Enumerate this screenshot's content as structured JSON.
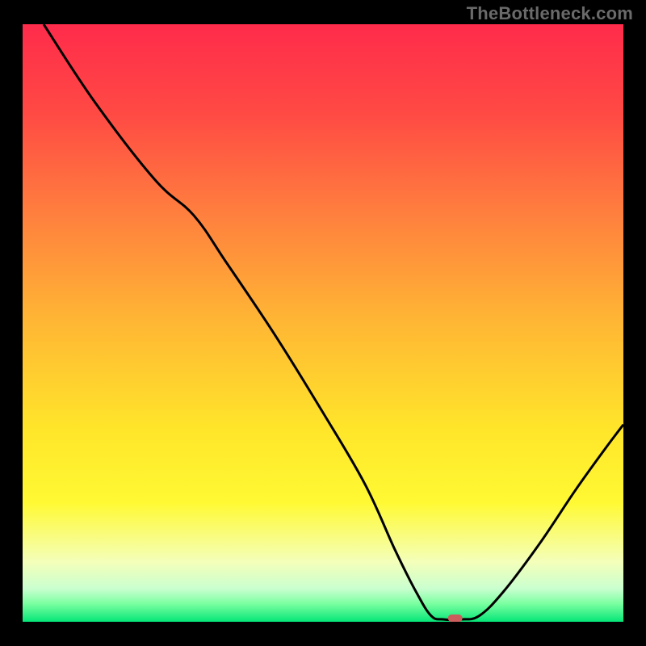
{
  "watermark": "TheBottleneck.com",
  "chart_data": {
    "type": "line",
    "title": "",
    "xlabel": "",
    "ylabel": "",
    "xlim": [
      0,
      100
    ],
    "ylim": [
      0,
      100
    ],
    "background_gradient": {
      "stops": [
        {
          "pos": 0.0,
          "color": "#ff2b4b"
        },
        {
          "pos": 0.15,
          "color": "#ff4a44"
        },
        {
          "pos": 0.32,
          "color": "#ff803e"
        },
        {
          "pos": 0.5,
          "color": "#ffb734"
        },
        {
          "pos": 0.68,
          "color": "#ffe62a"
        },
        {
          "pos": 0.8,
          "color": "#fff933"
        },
        {
          "pos": 0.9,
          "color": "#f4ffba"
        },
        {
          "pos": 0.945,
          "color": "#c9ffcf"
        },
        {
          "pos": 0.97,
          "color": "#7affa0"
        },
        {
          "pos": 1.0,
          "color": "#05e678"
        }
      ]
    },
    "series": [
      {
        "name": "bottleneck-curve",
        "color": "#000000",
        "points": [
          {
            "x": 3.5,
            "y": 100.0
          },
          {
            "x": 12.0,
            "y": 87.0
          },
          {
            "x": 22.0,
            "y": 74.0
          },
          {
            "x": 28.5,
            "y": 68.0
          },
          {
            "x": 34.0,
            "y": 60.0
          },
          {
            "x": 42.0,
            "y": 48.0
          },
          {
            "x": 50.0,
            "y": 35.0
          },
          {
            "x": 57.0,
            "y": 23.0
          },
          {
            "x": 62.0,
            "y": 12.0
          },
          {
            "x": 65.5,
            "y": 5.0
          },
          {
            "x": 68.0,
            "y": 1.0
          },
          {
            "x": 70.0,
            "y": 0.4
          },
          {
            "x": 73.0,
            "y": 0.4
          },
          {
            "x": 76.0,
            "y": 1.0
          },
          {
            "x": 80.0,
            "y": 5.0
          },
          {
            "x": 86.0,
            "y": 13.0
          },
          {
            "x": 92.0,
            "y": 22.0
          },
          {
            "x": 97.0,
            "y": 29.0
          },
          {
            "x": 100.0,
            "y": 33.0
          }
        ]
      }
    ],
    "marker": {
      "name": "optimal-point",
      "x": 72.0,
      "y": 0.6,
      "color": "#cd5c5c",
      "shape": "capsule"
    }
  }
}
